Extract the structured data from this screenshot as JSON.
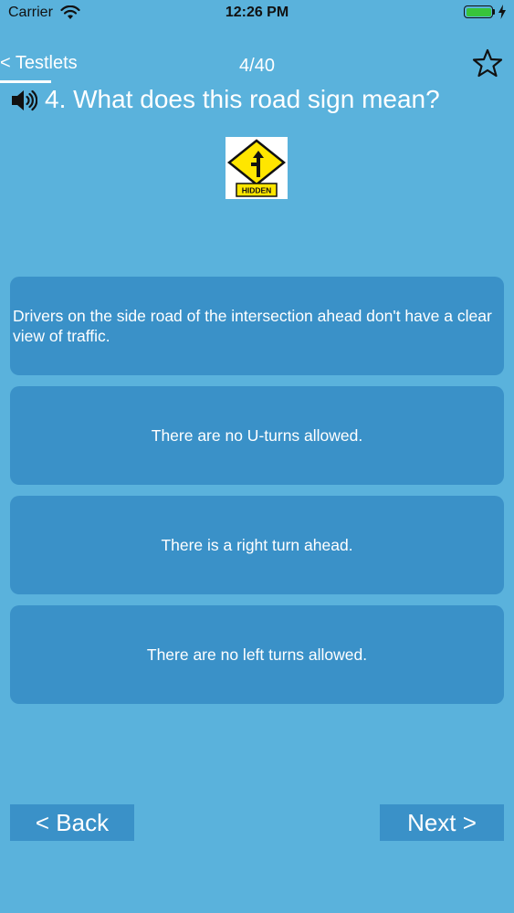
{
  "status_bar": {
    "carrier": "Carrier",
    "time": "12:26 PM",
    "battery_level": 1.0,
    "battery_color": "#38c43a"
  },
  "nav": {
    "back_label": "< Testlets",
    "counter": "4/40",
    "favorite_icon": "star-outline-icon"
  },
  "question": {
    "audio_icon": "speaker-icon",
    "text": "4. What does this road sign mean?",
    "sign_label": "HIDDEN"
  },
  "answers": [
    {
      "text": "Drivers on the side road of the intersection ahead don't have a clear view of traffic."
    },
    {
      "text": "There are no U-turns allowed."
    },
    {
      "text": "There is a right turn ahead."
    },
    {
      "text": "There are no left turns allowed."
    }
  ],
  "footer": {
    "back_label": "< Back",
    "next_label": "Next >"
  },
  "colors": {
    "background": "#5ab2dc",
    "answer_bg": "#3a91c8",
    "sign_yellow": "#ffe600"
  }
}
